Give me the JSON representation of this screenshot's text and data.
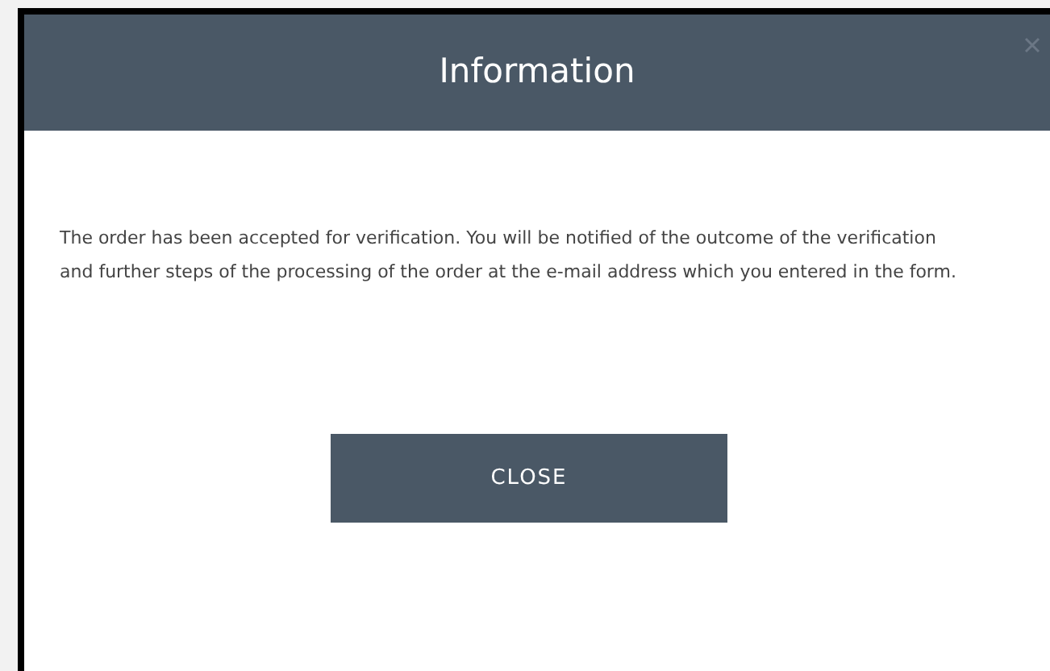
{
  "dialog": {
    "title": "Information",
    "message": "The order has been accepted for verification. You will be notified of the outcome of the verification and further steps of the processing of the order at the e-mail address which you entered in the form.",
    "buttons": [
      "CLOSE"
    ]
  }
}
